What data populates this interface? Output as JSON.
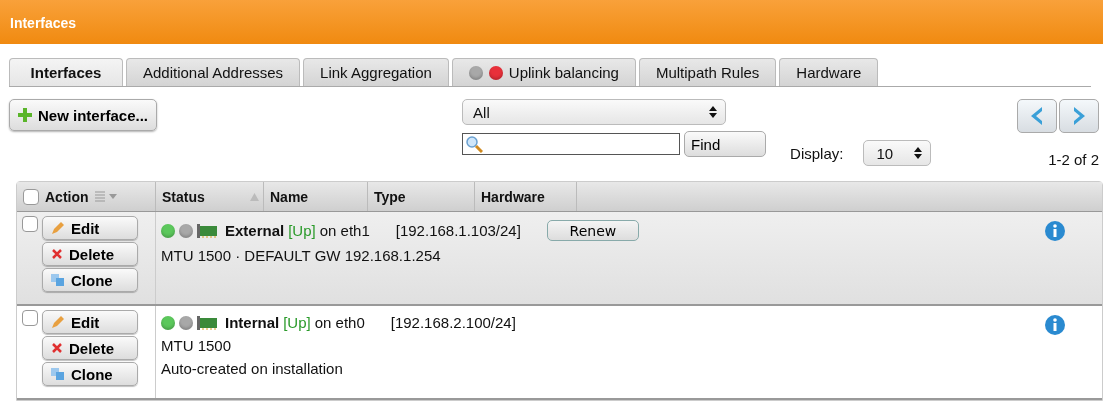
{
  "header": {
    "title": "Interfaces"
  },
  "tabs": [
    {
      "label": "Interfaces",
      "selected": true
    },
    {
      "label": "Additional Addresses",
      "selected": false
    },
    {
      "label": "Link Aggregation",
      "selected": false
    },
    {
      "label": "Uplink balancing",
      "selected": false,
      "lights": [
        {
          "color": "#a8a8a8"
        },
        {
          "color": "#e8303a"
        }
      ]
    },
    {
      "label": "Multipath Rules",
      "selected": false
    },
    {
      "label": "Hardware",
      "selected": false
    }
  ],
  "toolbar": {
    "new_button": "New interface...",
    "filter": "All",
    "find_button": "Find",
    "display_label": "Display:",
    "display_value": "10",
    "range": "1-2 of 2"
  },
  "table": {
    "select_all": false,
    "columns": [
      "Action",
      "Status",
      "Name",
      "Type",
      "Hardware"
    ],
    "rows": [
      {
        "selected": true,
        "checked": false,
        "actions": [
          "Edit",
          "Delete",
          "Clone"
        ],
        "lights": [
          {
            "color": "#5cc85c"
          },
          {
            "color": "#a8a8a8"
          }
        ],
        "name": "External",
        "state": "[Up]",
        "device": "on eth1",
        "address": "[192.168.1.103/24]",
        "renew": "Renew",
        "details": [
          "MTU 1500 · DEFAULT GW 192.168.1.254"
        ]
      },
      {
        "selected": false,
        "checked": false,
        "actions": [
          "Edit",
          "Delete",
          "Clone"
        ],
        "lights": [
          {
            "color": "#5cc85c"
          },
          {
            "color": "#a8a8a8"
          }
        ],
        "name": "Internal",
        "state": "[Up]",
        "device": "on eth0",
        "address": "[192.168.2.100/24]",
        "details": [
          "MTU 1500",
          "Auto-created on installation"
        ]
      }
    ]
  }
}
